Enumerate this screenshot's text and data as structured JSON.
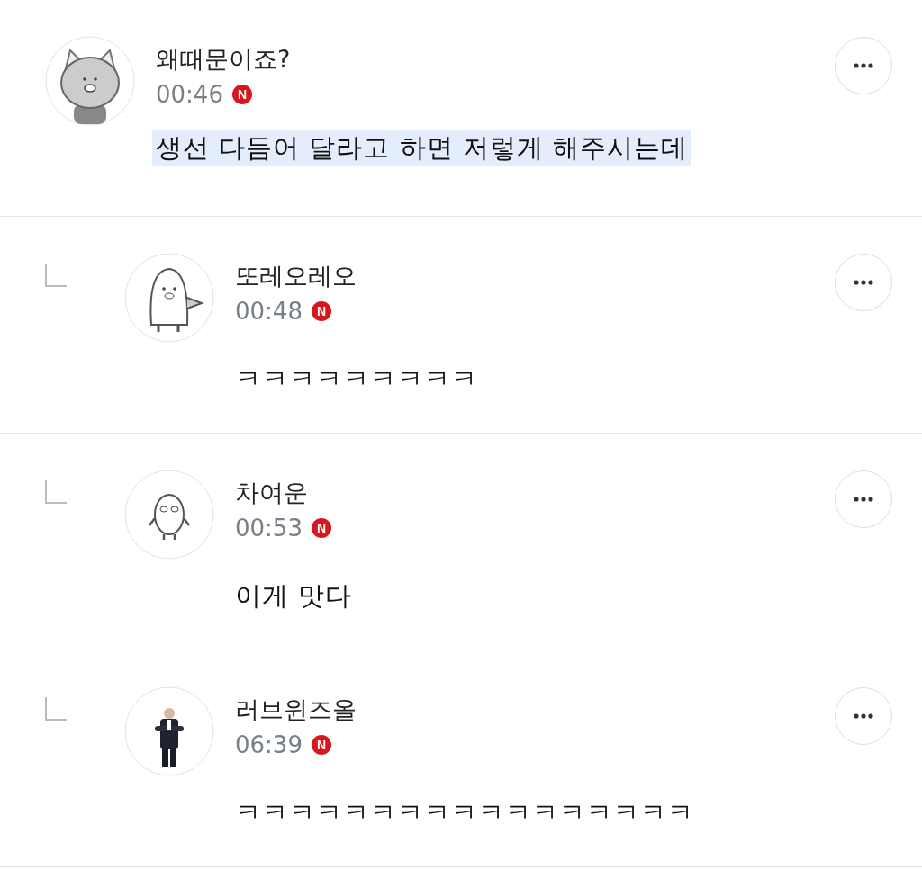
{
  "comments": [
    {
      "reply": false,
      "avatar": {
        "kind": "cat"
      },
      "author": "왜때문이죠?",
      "time": "00:46",
      "badge": "N",
      "text": "생선 다듬어 달라고 하면 저렇게 해주시는데",
      "highlighted": true
    },
    {
      "reply": true,
      "avatar": {
        "kind": "penguin"
      },
      "author": "또레오레오",
      "time": "00:48",
      "badge": "N",
      "text": "ㅋㅋㅋㅋㅋㅋㅋㅋㅋ",
      "highlighted": false
    },
    {
      "reply": true,
      "avatar": {
        "kind": "blob"
      },
      "author": "차여운",
      "time": "00:53",
      "badge": "N",
      "text": "이게 맛다",
      "highlighted": false
    },
    {
      "reply": true,
      "author": "러브윈즈올",
      "time": "06:39",
      "badge": "N",
      "text": "ㅋㅋㅋㅋㅋㅋㅋㅋㅋㅋㅋㅋㅋㅋㅋㅋㅋ",
      "highlighted": false
    }
  ]
}
